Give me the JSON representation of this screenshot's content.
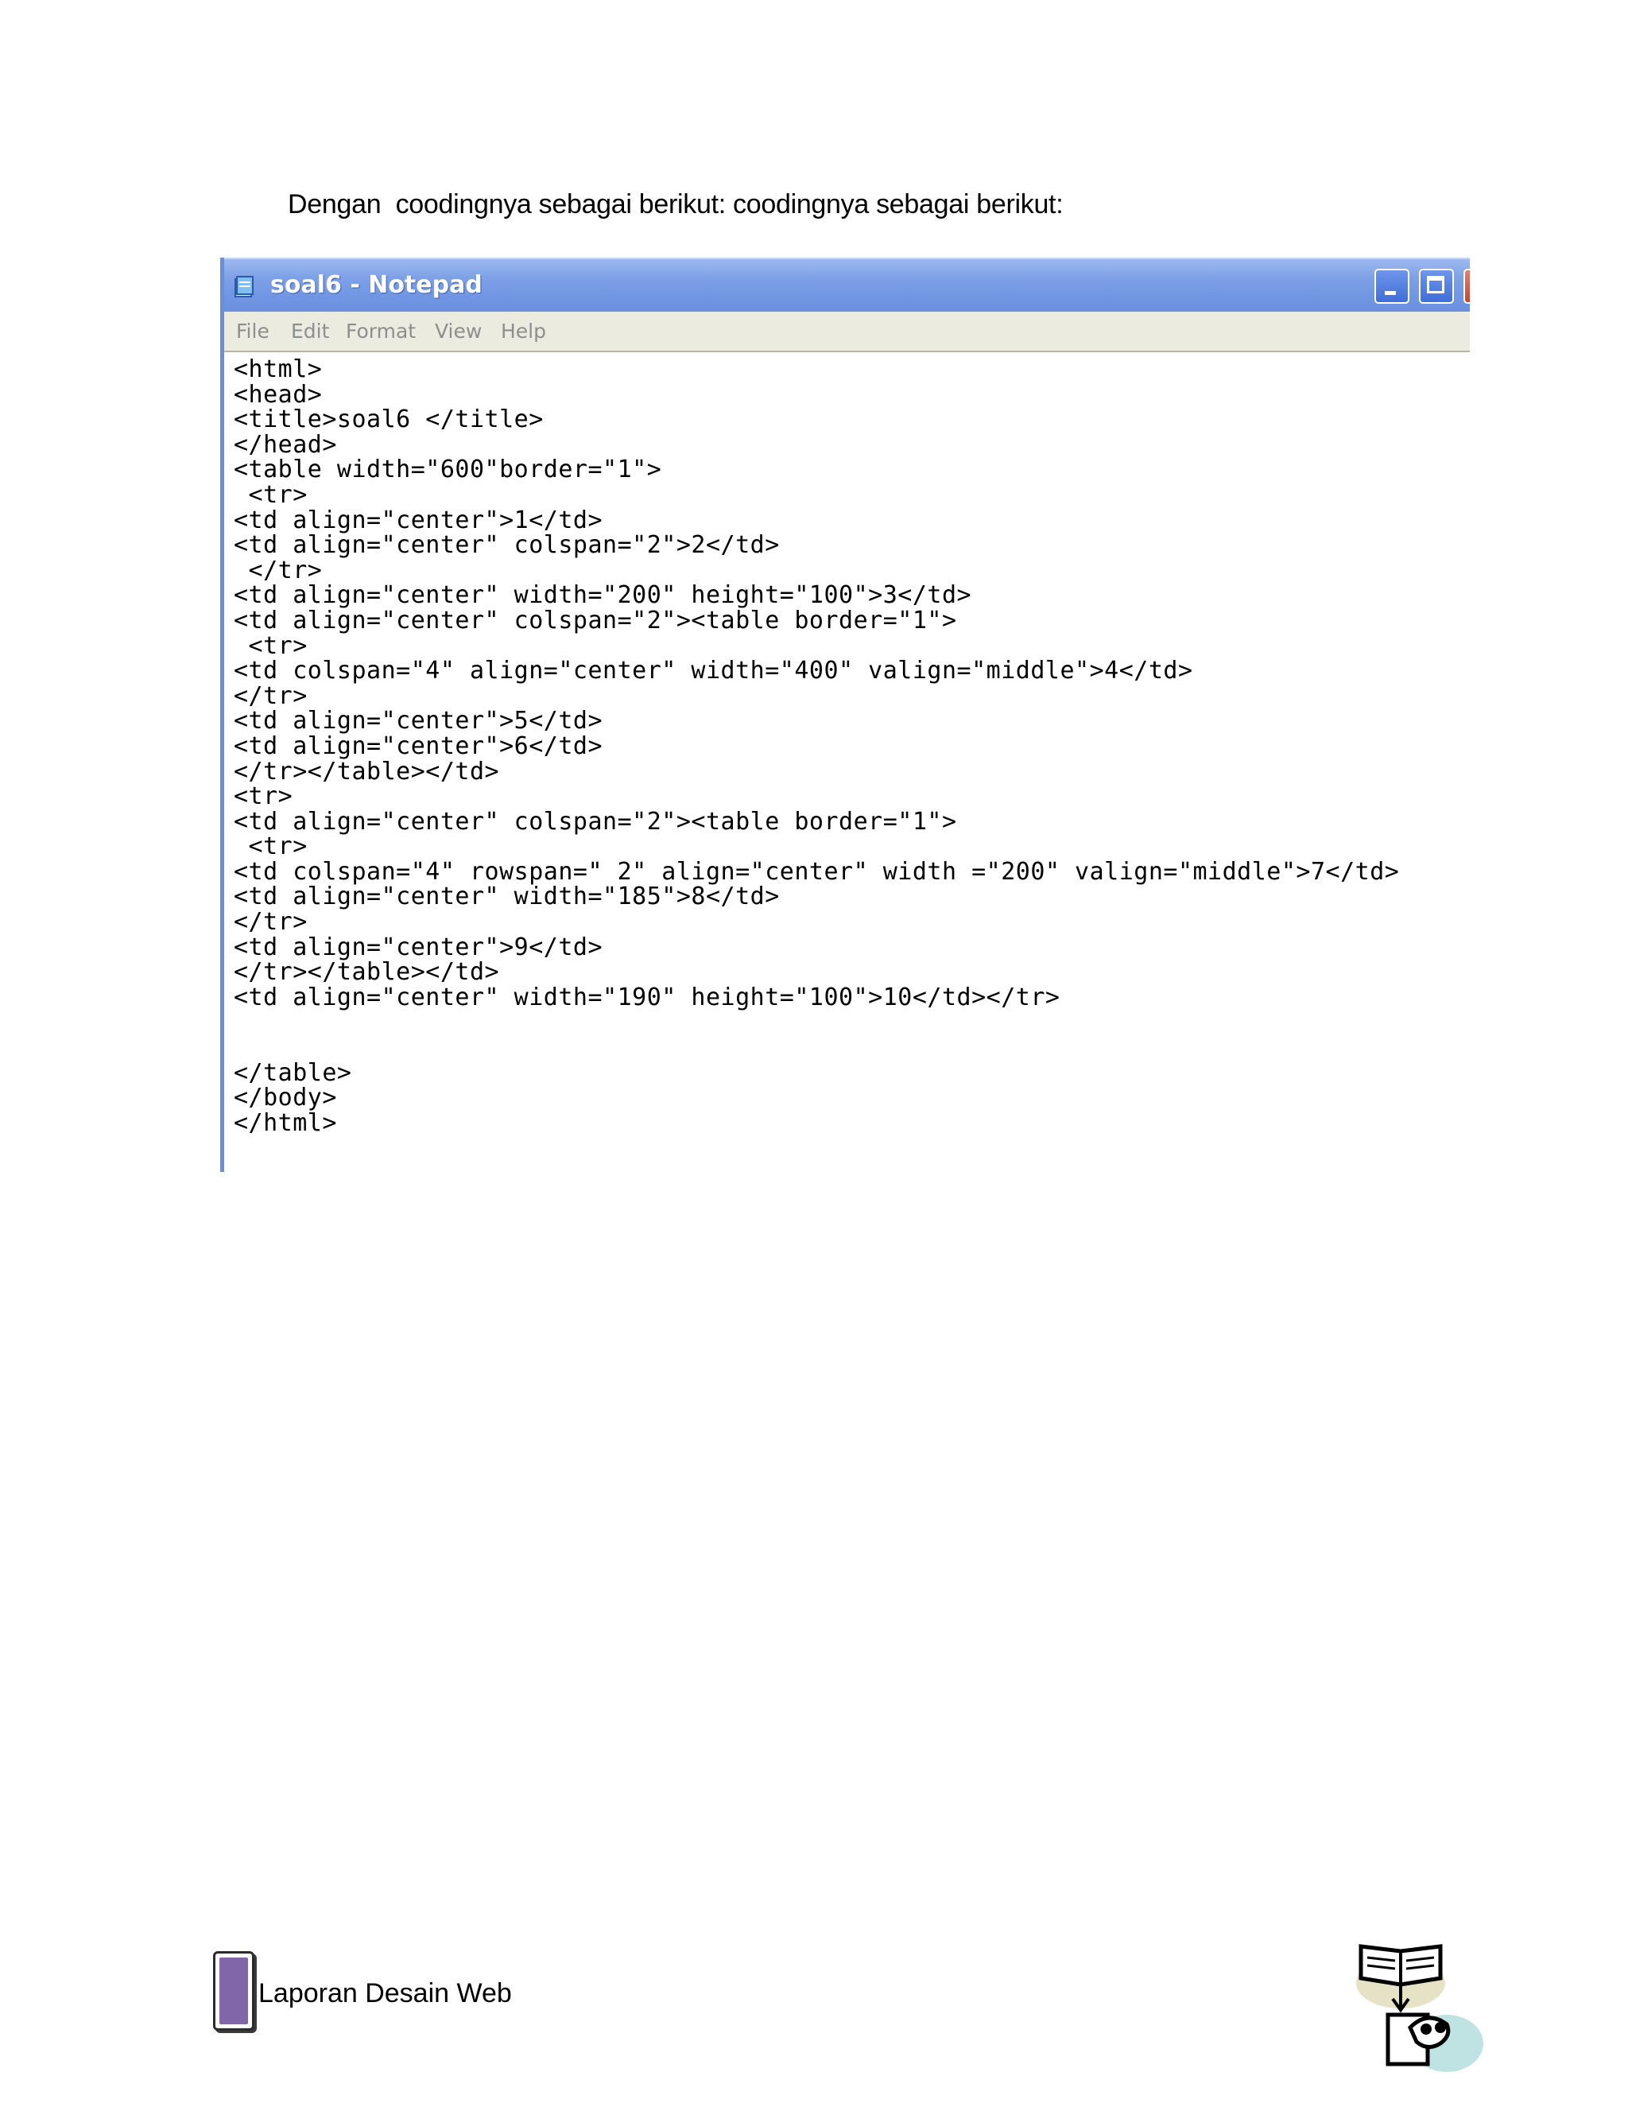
{
  "document": {
    "intro_text": "Dengan  coodingnya sebagai berikut: coodingnya sebagai berikut:",
    "footer_text": "Laporan Desain Web"
  },
  "notepad": {
    "title": "soal6 - Notepad",
    "menu": [
      "File",
      "Edit",
      "Format",
      "View",
      "Help"
    ],
    "code_lines": [
      "<html>",
      "<head>",
      "<title>soal6 </title>",
      "</head>",
      "<table width=\"600\"border=\"1\">",
      " <tr>",
      "<td align=\"center\">1</td>",
      "<td align=\"center\" colspan=\"2\">2</td>",
      " </tr>",
      "<td align=\"center\" width=\"200\" height=\"100\">3</td>",
      "<td align=\"center\" colspan=\"2\"><table border=\"1\">",
      " <tr>",
      "<td colspan=\"4\" align=\"center\" width=\"400\" valign=\"middle\">4</td>",
      "</tr>",
      "<td align=\"center\">5</td>",
      "<td align=\"center\">6</td>",
      "</tr></table></td>",
      "<tr>",
      "<td align=\"center\" colspan=\"2\"><table border=\"1\">",
      " <tr>",
      "<td colspan=\"4\" rowspan=\" 2\" align=\"center\" width =\"200\" valign=\"middle\">7</td>",
      "<td align=\"center\" width=\"185\">8</td>",
      "</tr>",
      "<td align=\"center\">9</td>",
      "</tr></table></td>",
      "<td align=\"center\" width=\"190\" height=\"100\">10</td></tr>",
      "",
      "",
      "</table>",
      "</body>",
      "</html>"
    ]
  },
  "colors": {
    "titlebar": "#7196e3",
    "menubar": "#ecebe0",
    "footer_accent": "#8167a9"
  },
  "icons": [
    "notepad-app-icon",
    "minimize-icon",
    "maximize-icon",
    "close-icon",
    "book-reader-clipart"
  ]
}
